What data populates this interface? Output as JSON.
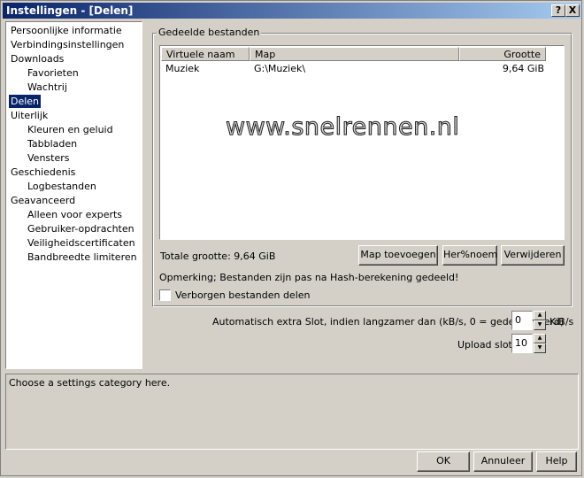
{
  "window": {
    "title": "Instellingen - [Delen]",
    "help_btn": "?",
    "close_btn": "X"
  },
  "tree": {
    "items": [
      {
        "label": "Persoonlijke informatie"
      },
      {
        "label": "Verbindingsinstellingen"
      },
      {
        "label": "Downloads"
      },
      {
        "label": "Favorieten"
      },
      {
        "label": "Wachtrij"
      },
      {
        "label": "Delen",
        "selected": true
      },
      {
        "label": "Uiterlijk"
      },
      {
        "label": "Kleuren en geluid"
      },
      {
        "label": "Tabbladen"
      },
      {
        "label": "Vensters"
      },
      {
        "label": "Geschiedenis"
      },
      {
        "label": "Logbestanden"
      },
      {
        "label": "Geavanceerd"
      },
      {
        "label": "Alleen voor experts"
      },
      {
        "label": "Gebruiker-opdrachten"
      },
      {
        "label": "Veiligheidscertificaten"
      },
      {
        "label": "Bandbreedte limiteren"
      }
    ]
  },
  "shared": {
    "group_title": "Gedeelde bestanden",
    "columns": [
      "Virtuele naam",
      "Map",
      "Grootte"
    ],
    "rows": [
      {
        "name": "Muziek",
        "path": "G:\\Muziek\\",
        "size": "9,64 GiB"
      }
    ],
    "watermark": "www.snelrennen.nl",
    "total_size": "Totale grootte: 9,64 GiB",
    "add_button": "Map toevoegen",
    "rename_button": "Her%noem",
    "remove_button": "Verwijderen",
    "note": "Opmerking; Bestanden zijn pas na Hash-berekening gedeeld!",
    "hidden_label": "Verborgen bestanden delen",
    "hidden_checked": false
  },
  "extra_slot": {
    "label": "Automatisch extra Slot, indien langzamer dan (kB/s, 0 = gedeactiveerd)",
    "value": "0",
    "unit": "KiB/s"
  },
  "upload_slots": {
    "label": "Upload slots",
    "value": "10"
  },
  "status": {
    "text": "Choose a settings category here."
  },
  "buttons": {
    "ok": "OK",
    "cancel": "Annuleer",
    "help": "Help"
  }
}
